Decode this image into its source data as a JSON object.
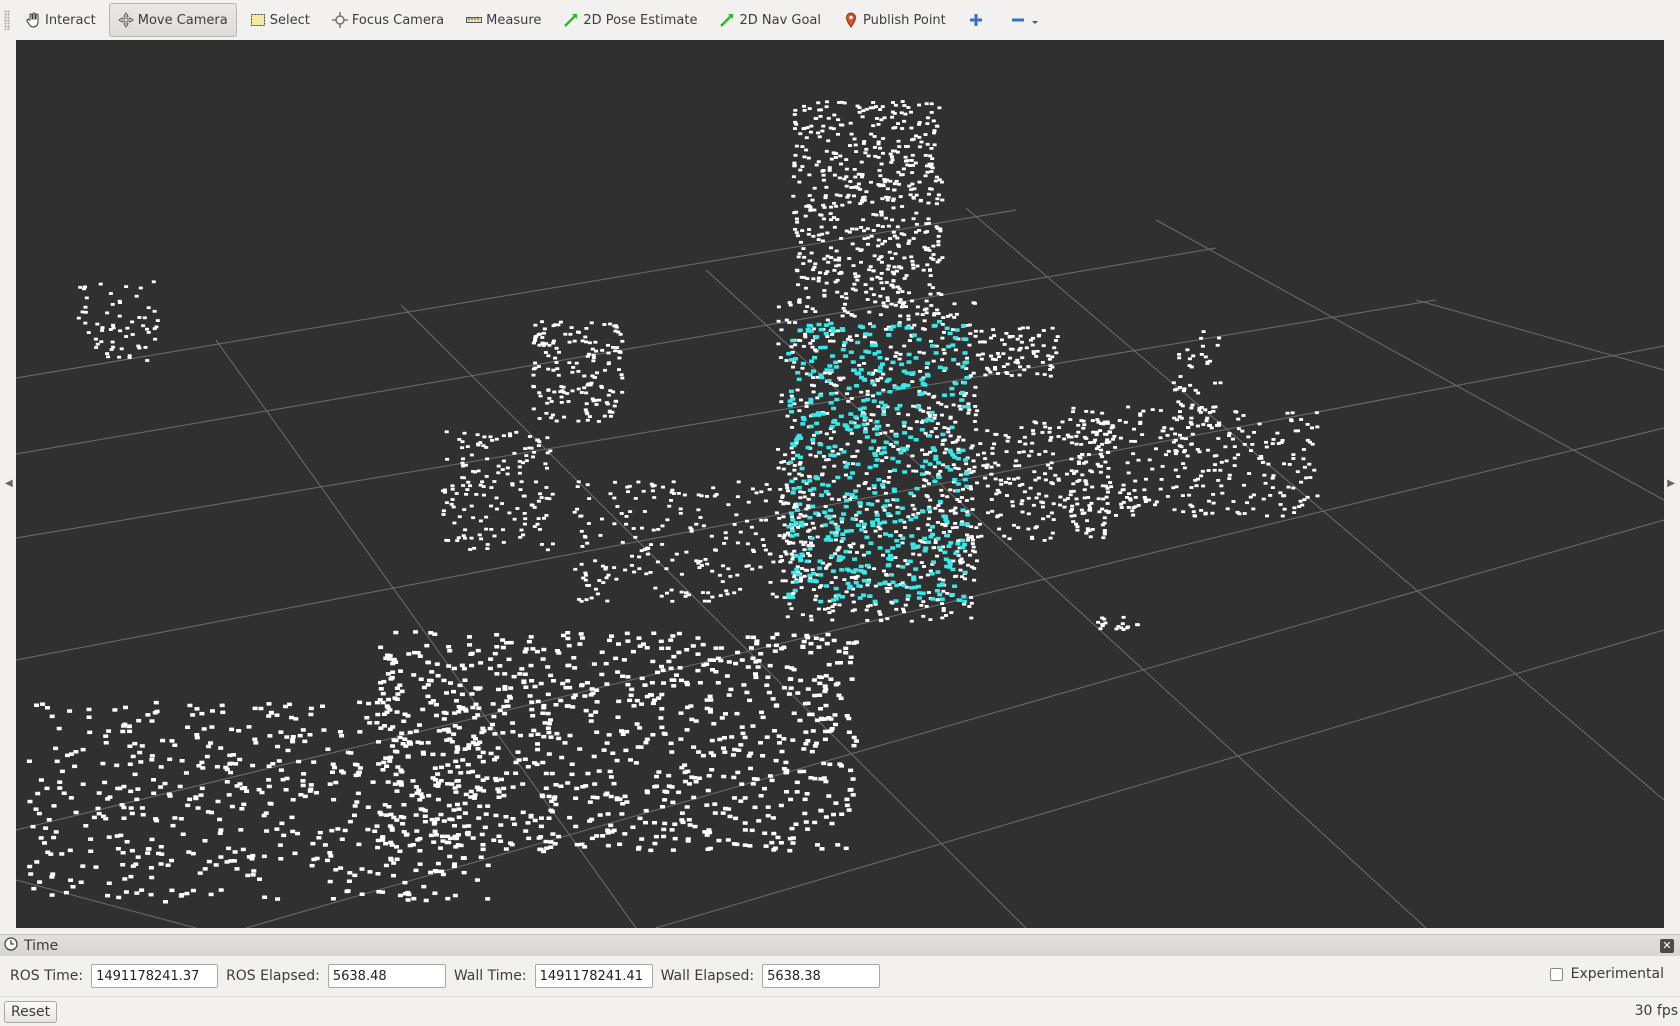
{
  "toolbar": {
    "tools": [
      {
        "label": "Interact",
        "icon": "hand-icon"
      },
      {
        "label": "Move Camera",
        "icon": "move-camera-icon"
      },
      {
        "label": "Select",
        "icon": "select-box-icon"
      },
      {
        "label": "Focus Camera",
        "icon": "focus-crosshair-icon"
      },
      {
        "label": "Measure",
        "icon": "ruler-icon"
      },
      {
        "label": "2D Pose Estimate",
        "icon": "green-arrow-icon"
      },
      {
        "label": "2D Nav Goal",
        "icon": "green-arrow-icon"
      },
      {
        "label": "Publish Point",
        "icon": "map-pin-icon"
      }
    ],
    "active_tool": "Move Camera"
  },
  "viewport": {
    "background_color": "#303030",
    "grid_color": "#6e6e6e",
    "point_color_primary": "#ffffff",
    "point_color_highlight": "#38e8e8"
  },
  "time_panel": {
    "title": "Time",
    "ros_time_label": "ROS Time:",
    "ros_time_value": "1491178241.37",
    "ros_elapsed_label": "ROS Elapsed:",
    "ros_elapsed_value": "5638.48",
    "wall_time_label": "Wall Time:",
    "wall_time_value": "1491178241.41",
    "wall_elapsed_label": "Wall Elapsed:",
    "wall_elapsed_value": "5638.38",
    "experimental_label": "Experimental",
    "experimental_checked": false
  },
  "footer": {
    "reset_label": "Reset",
    "fps": "30 fps"
  }
}
